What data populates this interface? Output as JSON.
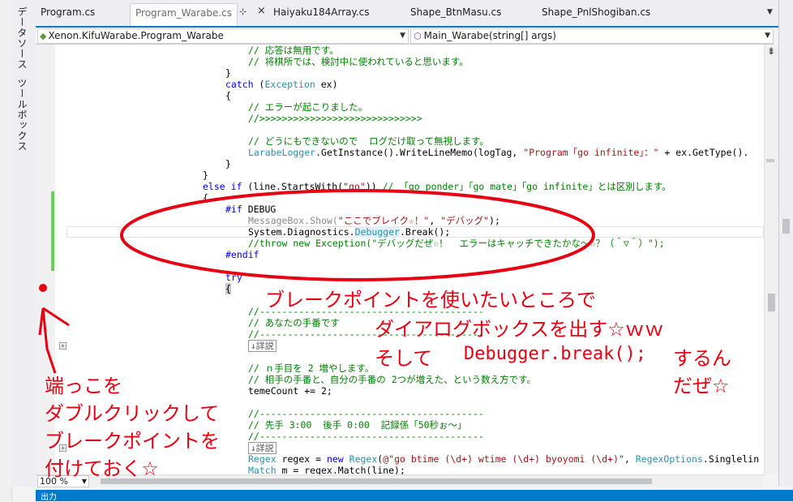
{
  "left_panel": {
    "tabs": [
      "データソース",
      "ツールボックス"
    ]
  },
  "tabs": [
    {
      "label": "Program.cs"
    },
    {
      "label": "Program_Warabe.cs",
      "active": true
    },
    {
      "label": "Haiyaku184Array.cs"
    },
    {
      "label": "Shape_BtnMasu.cs"
    },
    {
      "label": "Shape_PnlShogiban.cs"
    }
  ],
  "tab_pin_symbol": "⊹",
  "tab_close_symbol": "×",
  "navbar": {
    "class_combo": "Xenon.KifuWarabe.Program_Warabe",
    "member_combo": "Main_Warabe(string[] args)"
  },
  "code": {
    "l01": "// 応答は無用です。",
    "l02": "// 将棋所では、検討中に使われていると思います。",
    "l03": "}",
    "l04_kw": "catch",
    "l04_ty": "Exception",
    "l04_rest": " ex)",
    "l05": "{",
    "l06": "// エラーが起こりました。",
    "l07": "//>>>>>>>>>>>>>>>>>>>>>>>>>>>>>",
    "l08": "// どうにもできないので  ログだけ取って無視します。",
    "l09_ty": "LarabeLogger",
    "l09_mid": ".GetInstance().WriteLineMemo(logTag, ",
    "l09_st": "\"Program「go infinite」：\"",
    "l09_end": " + ex.GetType().",
    "l10": "}",
    "l11": "}",
    "l12_kw1": "else",
    "l12_kw2": "if",
    "l12_mid": " (line.StartsWith(",
    "l12_st": "\"go\"",
    "l12_end": ")) ",
    "l12_cm": "// 「go ponder」「go mate」「go infinite」とは区別します。",
    "l13": "{",
    "l14_pp": "#if",
    "l14_rest": " DEBUG",
    "l15_ty": "MessageBox",
    "l15_mid": ".Show(",
    "l15_st1": "\"ここでブレイク☆！\"",
    "l15_sep": ", ",
    "l15_st2": "\"デバッグ\"",
    "l15_end": ");",
    "l16_a": "System.Diagnostics.",
    "l16_ty": "Debugger",
    "l16_b": ".Break();",
    "l17": "//throw new Exception(\"デバッグだぜ☆！  エラーはキャッチできたかな～☆？（＾▽＾）\");",
    "l18": "#endif",
    "l19": "try",
    "l20": "{",
    "l21": "//----------------------------------------",
    "l22": "// あなたの手番です",
    "l23": "//----------------------------------------",
    "l24": "↓詳説",
    "l25": "// ｎ手目を 2 増やします。",
    "l26": "// 相手の手番と、自分の手番の 2つが増えた、という数え方です。",
    "l27": "temeCount += 2;",
    "l28": "//----------------------------------------",
    "l29": "// 先手 3:00  後手 0:00  記録係「50秒ぉ～」",
    "l30": "//----------------------------------------",
    "l31": "↓詳説",
    "l32_ty": "Regex",
    "l32_a": " regex = ",
    "l32_kw": "new",
    "l32_ty2": "Regex",
    "l32_b": "(",
    "l32_st": "@\"go btime (\\d+) wtime (\\d+) byoyomi (\\d+)\"",
    "l32_c": ", ",
    "l32_ty3": "RegexOptions",
    "l32_d": ".Singlelin",
    "l33_ty": "Match",
    "l33_rest": " m = regex.Match(line);"
  },
  "zoom": "100 %",
  "output_panel_title": "出力",
  "annotations": {
    "top_line1": "ブレークポイントを使いたいところで",
    "top_line2": "ダイアログボックスを出す☆ｗｗ",
    "top_line3a": "そして",
    "top_line3b": "Debugger.break();",
    "top_line3c": "するん",
    "top_line4": "だぜ☆",
    "left_line1": "端っこを",
    "left_line2": "ダブルクリックして",
    "left_line3": "ブレークポイントを",
    "left_line4": "付けておく☆"
  },
  "colors": {
    "annotation_red": "#e60012",
    "accent_blue": "#007acc",
    "change_bar_green": "#6bcf5e"
  }
}
